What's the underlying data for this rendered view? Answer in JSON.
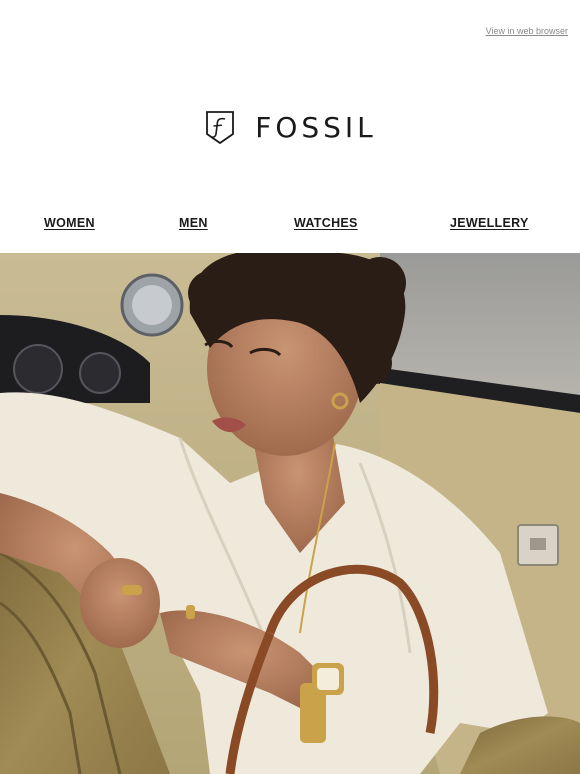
{
  "header": {
    "web_browser_link": "View in web browser",
    "brand": "FOSSIL",
    "logo_icon": "fossil-f-shield-icon"
  },
  "nav": {
    "items": [
      {
        "label": "WOMEN"
      },
      {
        "label": "MEN"
      },
      {
        "label": "WATCHES"
      },
      {
        "label": "JEWELLERY"
      }
    ]
  },
  "hero": {
    "subject": "hero-photo",
    "colors": {
      "seat": "#a08a55",
      "blouse": "#efe9dc",
      "skin": "#b98264",
      "hair": "#2a1d16",
      "bag_strap": "#8a4a26",
      "gold": "#c9a24a"
    }
  }
}
